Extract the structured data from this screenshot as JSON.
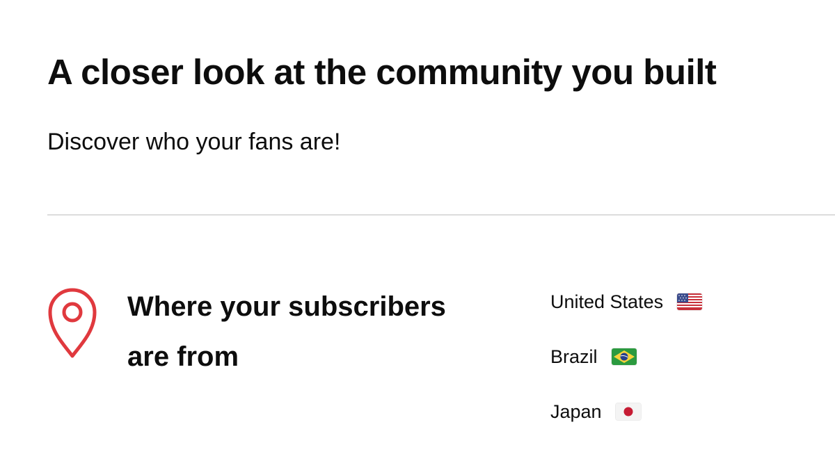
{
  "header": {
    "title": "A closer look at the community you built",
    "subtitle": "Discover who your fans are!"
  },
  "location_section": {
    "icon": "location-pin-icon",
    "heading": "Where your subscribers are from",
    "countries": [
      {
        "name": "United States",
        "flag": "us-flag-icon"
      },
      {
        "name": "Brazil",
        "flag": "brazil-flag-icon"
      },
      {
        "name": "Japan",
        "flag": "japan-flag-icon"
      }
    ]
  },
  "colors": {
    "accent": "#e0393e",
    "text": "#0d0d0d",
    "divider": "#dcdcdc"
  }
}
